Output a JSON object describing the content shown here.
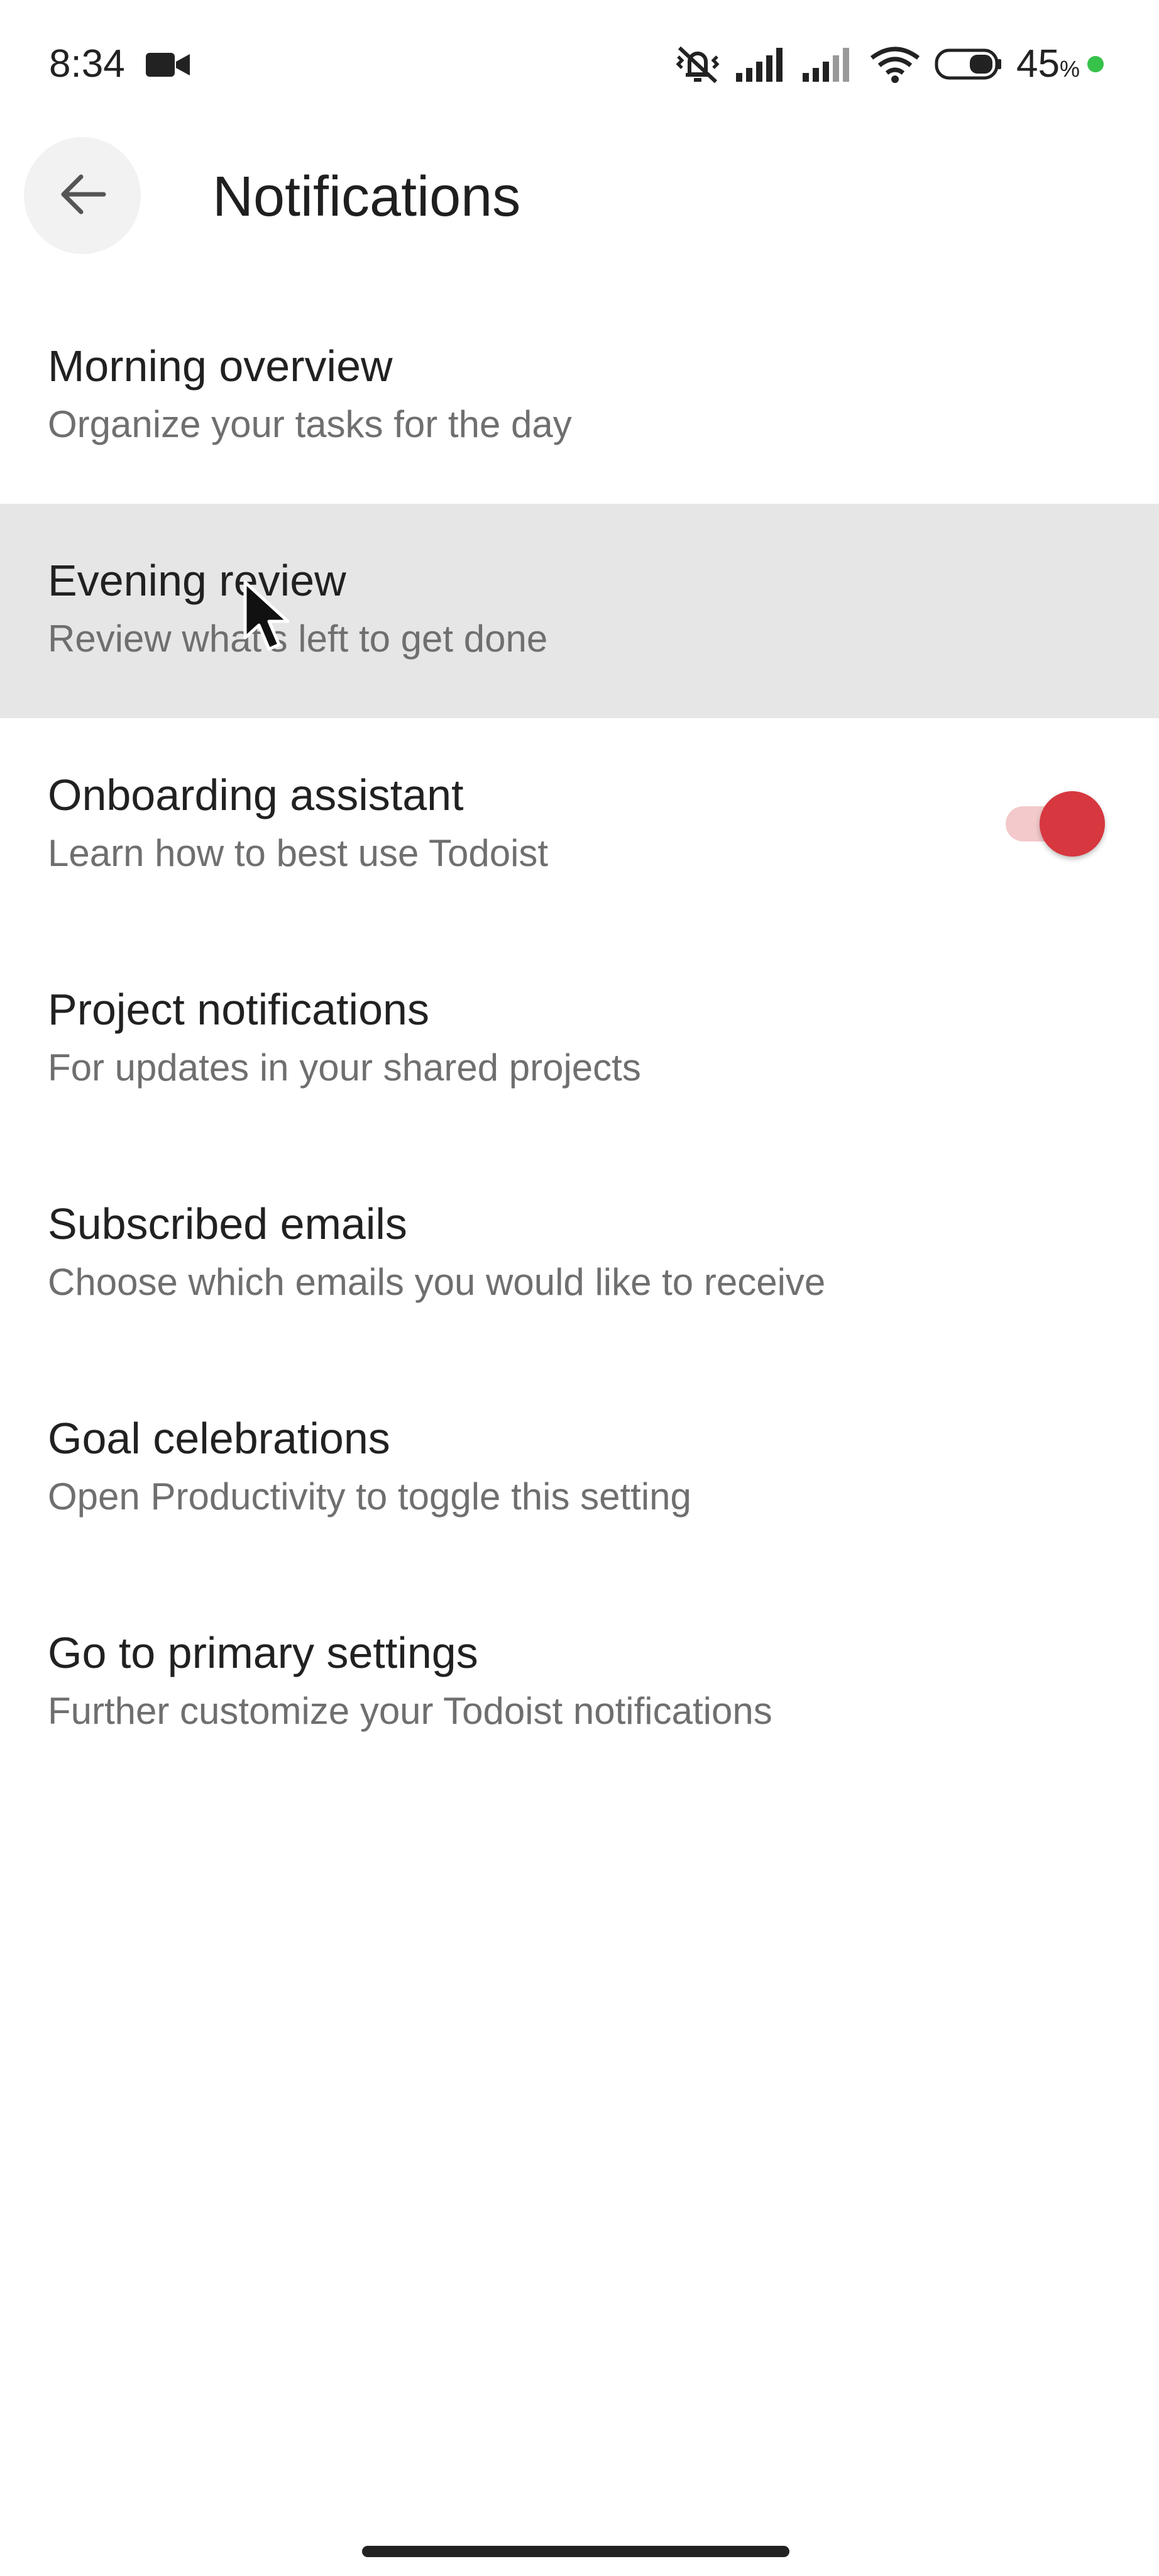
{
  "status_bar": {
    "time": "8:34",
    "camera_icon": "video-camera-icon",
    "icons": [
      "vibrate-off-icon",
      "signal-icon",
      "signal-icon",
      "wifi-icon",
      "battery-icon"
    ],
    "battery_percent": "45",
    "battery_percent_sign": "%",
    "charging_color": "#37c24a"
  },
  "app_bar": {
    "back_icon": "arrow-back-icon",
    "title": "Notifications"
  },
  "settings": [
    {
      "title": "Morning overview",
      "subtitle": "Organize your tasks for the day"
    },
    {
      "title": "Evening review",
      "subtitle": "Review what's left to get done",
      "pressed": true
    },
    {
      "title": "Onboarding assistant",
      "subtitle": "Learn how to best use Todoist",
      "toggle_on": true
    },
    {
      "title": "Project notifications",
      "subtitle": "For updates in your shared projects"
    },
    {
      "title": "Subscribed emails",
      "subtitle": "Choose which emails you would like to receive"
    },
    {
      "title": "Goal celebrations",
      "subtitle": "Open Productivity to toggle this setting"
    },
    {
      "title": "Go to primary settings",
      "subtitle": "Further customize your Todoist notifications"
    }
  ],
  "colors": {
    "accent": "#d7373f",
    "accent_track": "#f3c9cb",
    "pressed_row": "#e6e6e6"
  }
}
